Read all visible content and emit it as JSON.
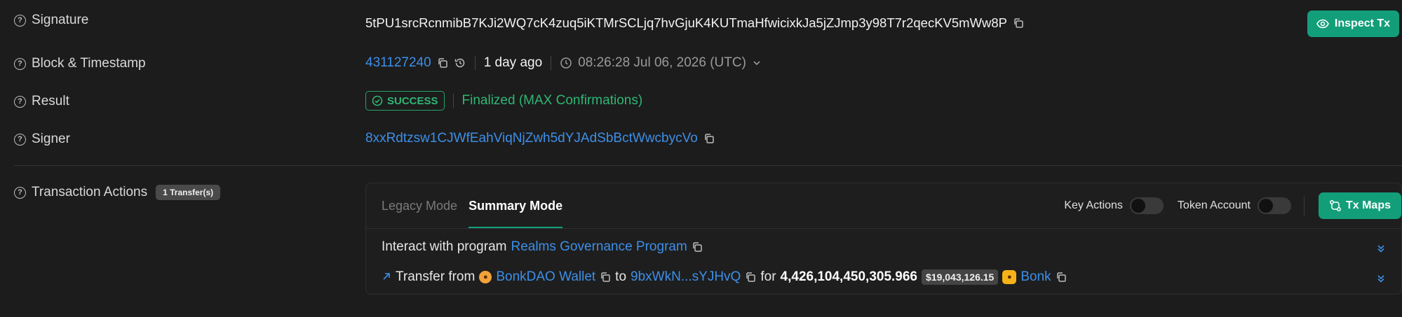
{
  "signature": {
    "label": "Signature",
    "value": "5tPU1srcRcnmibB7KJi2WQ7cK4zuq5iKTMrSCLjq7hvGjuK4KUTmaHfwicixkJa5jZJmp3y98T7r2qecKV5mWw8P"
  },
  "inspect_button": {
    "label": "Inspect Tx"
  },
  "block": {
    "label": "Block & Timestamp",
    "number": "431127240",
    "relative": "1 day ago",
    "timestamp": "08:26:28 Jul 06, 2026 (UTC)"
  },
  "result": {
    "label": "Result",
    "status": "SUCCESS",
    "finality": "Finalized (MAX Confirmations)"
  },
  "signer": {
    "label": "Signer",
    "address": "8xxRdtzsw1CJWfEahViqNjZwh5dYJAdSbBctWwcbycVo"
  },
  "actions": {
    "label": "Transaction Actions",
    "badge": "1 Transfer(s)",
    "tabs": [
      {
        "label": "Legacy Mode"
      },
      {
        "label": "Summary Mode"
      }
    ],
    "toggles": {
      "key_actions": "Key Actions",
      "token_account": "Token Account"
    },
    "tx_maps": "Tx Maps",
    "interact": {
      "prefix": "Interact with program",
      "program": "Realms Governance Program"
    },
    "transfer": {
      "prefix": "Transfer from",
      "from": "BonkDAO Wallet",
      "to_word": "to",
      "to": "9bxWkN...sYJHvQ",
      "for_word": "for",
      "amount": "4,426,104,450,305.966",
      "usd": "$19,043,126.15",
      "token": "Bonk"
    }
  },
  "colors": {
    "accent": "#139e7a",
    "link": "#3d8fe8",
    "success": "#2fb673",
    "background": "#1c1c1c"
  }
}
